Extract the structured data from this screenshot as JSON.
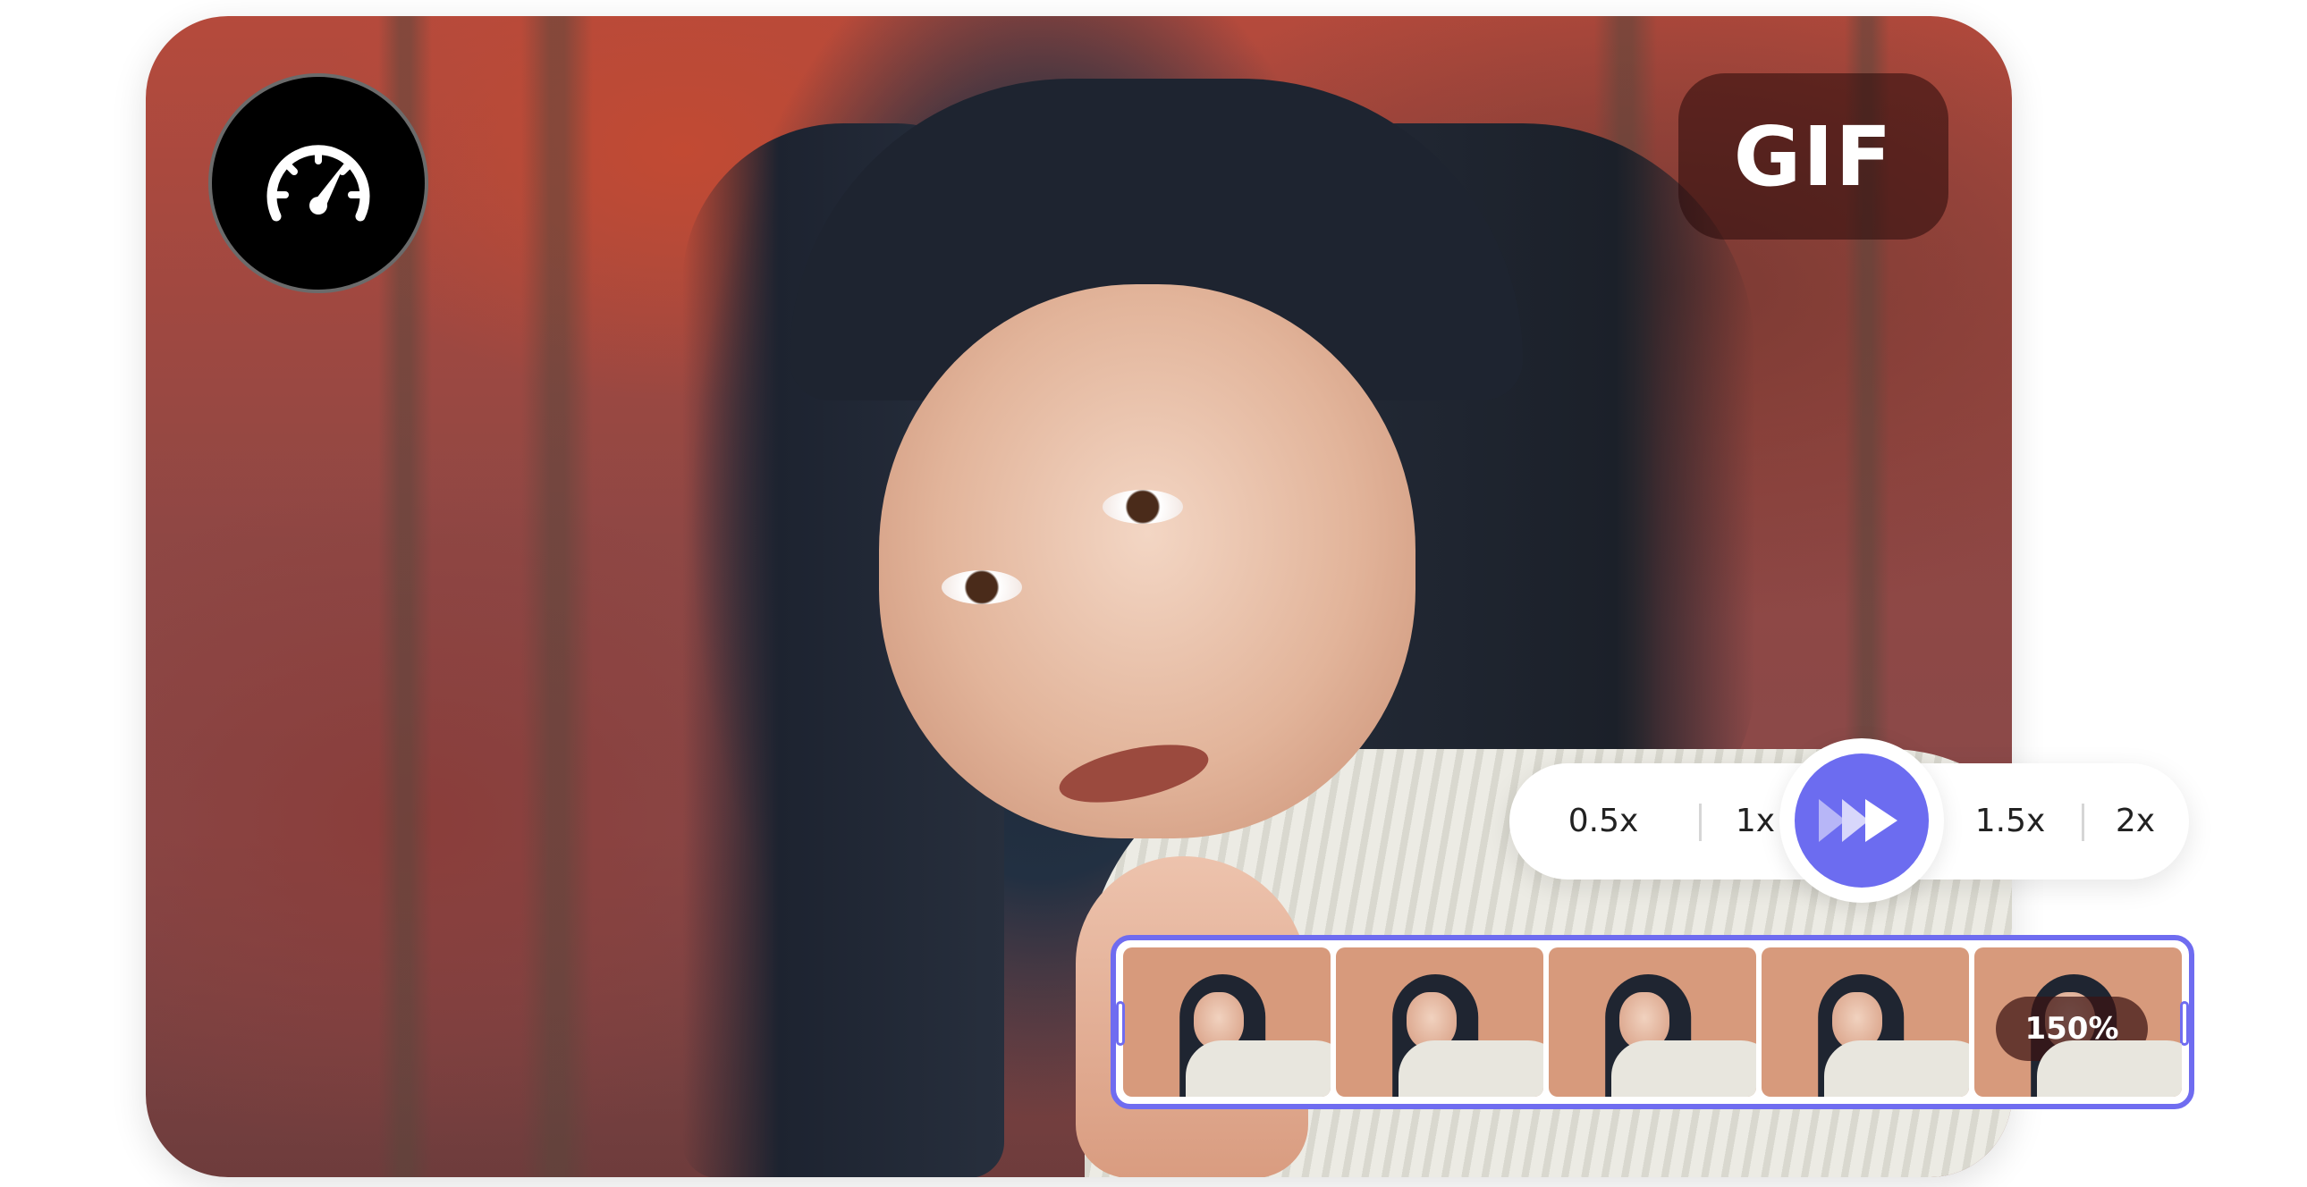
{
  "badge": {
    "format_label": "GIF"
  },
  "speed_icon": {
    "icon": "speedometer-icon"
  },
  "speed_selector": {
    "options": [
      "0.5x",
      "1x",
      "1.5x",
      "2x"
    ],
    "play_icon": "fast-forward-icon",
    "accent_color": "#6c6cf0"
  },
  "timeline": {
    "frame_count": 5,
    "speed_percent_label": "150%",
    "border_color": "#6f6cf0"
  }
}
